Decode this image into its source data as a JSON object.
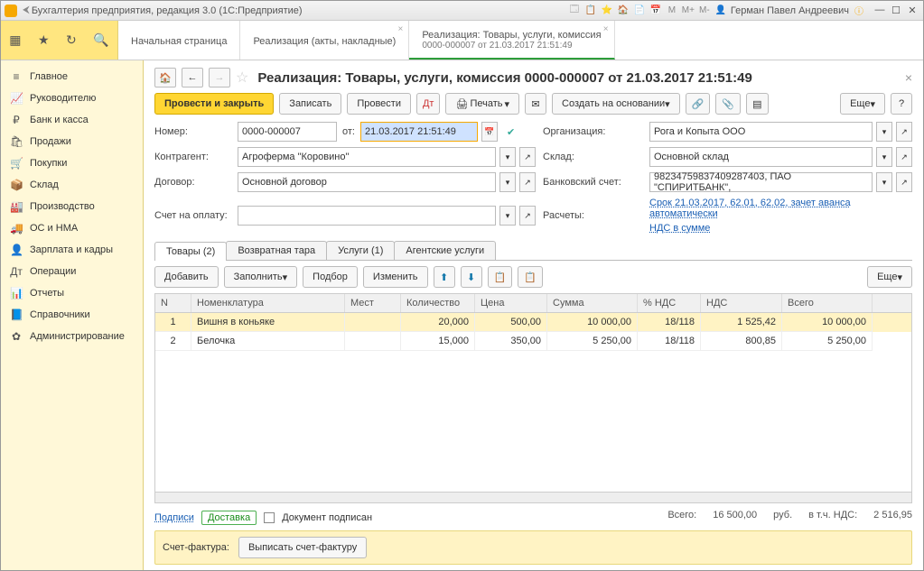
{
  "titlebar": {
    "app_title": "Бухгалтерия предприятия, редакция 3.0 (1С:Предприятие)",
    "m_labels": [
      "M",
      "M+",
      "M-"
    ],
    "user_name": "Герман Павел Андреевич"
  },
  "tabs": {
    "start": "Начальная страница",
    "sales_acts": "Реализация (акты, накладные)",
    "active_main": "Реализация: Товары, услуги, комиссия",
    "active_sub": "0000-000007 от 21.03.2017 21:51:49"
  },
  "sidebar": {
    "items": [
      {
        "icon": "≡",
        "label": "Главное"
      },
      {
        "icon": "📈",
        "label": "Руководителю"
      },
      {
        "icon": "₽",
        "label": "Банк и касса"
      },
      {
        "icon": "🛍",
        "label": "Продажи"
      },
      {
        "icon": "🛒",
        "label": "Покупки"
      },
      {
        "icon": "📦",
        "label": "Склад"
      },
      {
        "icon": "🏭",
        "label": "Производство"
      },
      {
        "icon": "🚚",
        "label": "ОС и НМА"
      },
      {
        "icon": "👤",
        "label": "Зарплата и кадры"
      },
      {
        "icon": "Дт",
        "label": "Операции"
      },
      {
        "icon": "📊",
        "label": "Отчеты"
      },
      {
        "icon": "📘",
        "label": "Справочники"
      },
      {
        "icon": "✿",
        "label": "Администрирование"
      }
    ]
  },
  "page": {
    "title": "Реализация: Товары, услуги, комиссия 0000-000007 от 21.03.2017 21:51:49"
  },
  "cmdbar": {
    "post_close": "Провести и закрыть",
    "save": "Записать",
    "post": "Провести",
    "print": "Печать",
    "create_based": "Создать на основании",
    "more": "Еще"
  },
  "fields": {
    "number_label": "Номер:",
    "number_value": "0000-000007",
    "from_label": "от:",
    "date_value": "21.03.2017 21:51:49",
    "org_label": "Организация:",
    "org_value": "Рога и Копыта ООО",
    "contr_label": "Контрагент:",
    "contr_value": "Агроферма \"Коровино\"",
    "wh_label": "Склад:",
    "wh_value": "Основной склад",
    "dog_label": "Договор:",
    "dog_value": "Основной договор",
    "bank_label": "Банковский счет:",
    "bank_value": "98234759837409287403, ПАО \"СПИРИТБАНК\",",
    "pay_label": "Счет на оплату:",
    "pay_value": "",
    "calc_label": "Расчеты:",
    "calc_link": "Срок 21.03.2017, 62.01, 62.02, зачет аванса автоматически",
    "nds_link": "НДС в сумме"
  },
  "subtabs": {
    "goods": "Товары (2)",
    "tara": "Возвратная тара",
    "services": "Услуги (1)",
    "agent": "Агентские услуги"
  },
  "tablebar": {
    "add": "Добавить",
    "fill": "Заполнить",
    "select": "Подбор",
    "change": "Изменить",
    "more": "Еще"
  },
  "gridheader": {
    "n": "N",
    "item": "Номенклатура",
    "places": "Мест",
    "qty": "Количество",
    "price": "Цена",
    "sum": "Сумма",
    "vatp": "% НДС",
    "vat": "НДС",
    "total": "Всего"
  },
  "rows": [
    {
      "n": "1",
      "item": "Вишня в коньяке",
      "places": "",
      "qty": "20,000",
      "price": "500,00",
      "sum": "10 000,00",
      "vatp": "18/118",
      "vat": "1 525,42",
      "total": "10 000,00"
    },
    {
      "n": "2",
      "item": "Белочка",
      "places": "",
      "qty": "15,000",
      "price": "350,00",
      "sum": "5 250,00",
      "vatp": "18/118",
      "vat": "800,85",
      "total": "5 250,00"
    }
  ],
  "footer": {
    "sign_link": "Подписи",
    "delivery_link": "Доставка",
    "signed_label": "Документ подписан",
    "total_label": "Всего:",
    "total_value": "16 500,00",
    "rub": "руб.",
    "vat_incl_label": "в т.ч. НДС:",
    "vat_value": "2 516,95"
  },
  "invoice": {
    "label": "Счет-фактура:",
    "btn": "Выписать счет-фактуру"
  }
}
